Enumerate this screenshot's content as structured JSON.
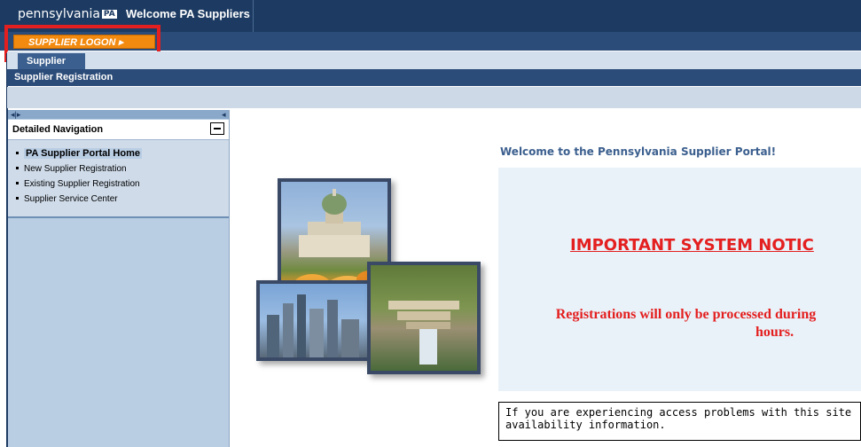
{
  "header": {
    "brand": "pennsylvania",
    "brand_badge": "PA",
    "title": "Welcome PA Suppliers"
  },
  "logon": {
    "label": "SUPPLIER LOGON ▸"
  },
  "tabs": [
    {
      "label": "Supplier"
    }
  ],
  "subnav": {
    "label": "Supplier Registration"
  },
  "sidebar": {
    "arrows": "◂|▸",
    "collapse": "◂",
    "title": "Detailed Navigation",
    "items": [
      {
        "label": "PA Supplier Portal Home",
        "active": true
      },
      {
        "label": "New Supplier Registration"
      },
      {
        "label": "Existing Supplier Registration"
      },
      {
        "label": "Supplier Service Center"
      }
    ]
  },
  "main": {
    "welcome": "Welcome to the Pennsylvania Supplier Portal!",
    "notice_heading": "IMPORTANT SYSTEM NOTIC",
    "notice_line1": "Registrations will only be processed during",
    "notice_line2": "hours.",
    "access_line1": "If you are experiencing access problems with this site",
    "access_line2": "availability information."
  },
  "colors": {
    "header": "#1d3b62",
    "logon_button": "#f28a10",
    "notice_red": "#e41f1f",
    "highlight_box": "#e41f1f"
  }
}
